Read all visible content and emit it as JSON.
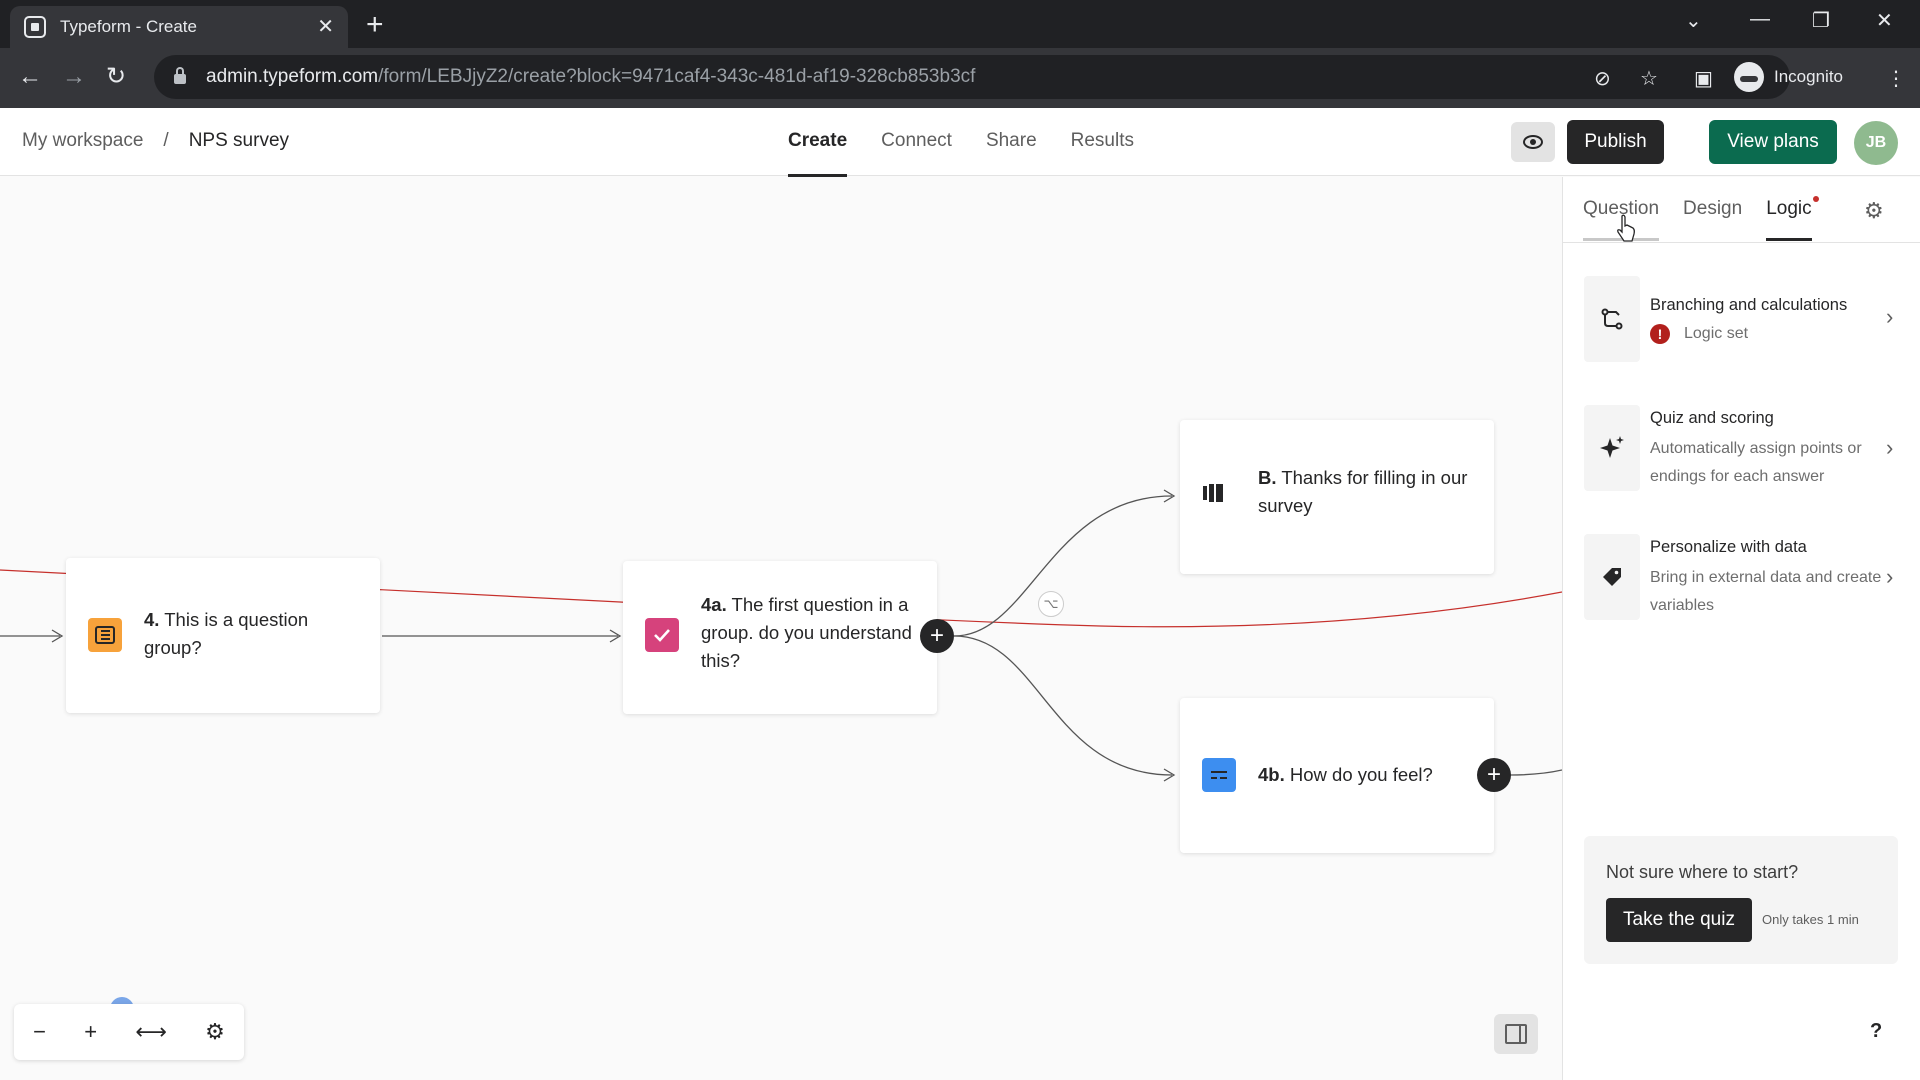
{
  "browser": {
    "tab_title": "Typeform - Create",
    "url_host": "admin.typeform.com",
    "url_path": "/form/LEBJjyZ2/create?block=9471caf4-343c-481d-af19-328cb853b3cf",
    "profile_label": "Incognito"
  },
  "header": {
    "breadcrumb": [
      "My workspace",
      "/",
      "NPS survey"
    ],
    "tabs": [
      "Create",
      "Connect",
      "Share",
      "Results"
    ],
    "active_tab": "Create",
    "publish_label": "Publish",
    "view_plans_label": "View plans",
    "avatar_initials": "JB"
  },
  "canvas": {
    "nodes": [
      {
        "id": "4",
        "number": "4.",
        "title": "This is a question group?",
        "icon": "question-group-icon",
        "color": "#f7a23b"
      },
      {
        "id": "4a",
        "number": "4a.",
        "title": "The first question in a group. do you understand this?",
        "icon": "checkbox-icon",
        "color": "#d6427c"
      },
      {
        "id": "B",
        "number": "B.",
        "title": "Thanks for filling in our survey",
        "icon": "ending-icon",
        "color": "#262627"
      },
      {
        "id": "4b",
        "number": "4b.",
        "title": "How do you feel?",
        "icon": "short-text-icon",
        "color": "#3d8ef0"
      }
    ]
  },
  "zoom_controls": [
    "−",
    "+",
    "⟷",
    "⚙"
  ],
  "panel": {
    "tabs": [
      "Question",
      "Design",
      "Logic"
    ],
    "active_tab": "Logic",
    "items": [
      {
        "title": "Branching and calculations",
        "subtitle": "Logic set",
        "icon": "branching-icon"
      },
      {
        "title": "Quiz and scoring",
        "subtitle": "Automatically assign points or endings for each answer",
        "icon": "sparkle-icon"
      },
      {
        "title": "Personalize with data",
        "subtitle": "Bring in external data and create variables",
        "icon": "tag-icon"
      }
    ],
    "quiz_prompt": "Not sure where to start?",
    "quiz_button": "Take the quiz",
    "quiz_note": "Only takes 1 min"
  },
  "help_label": "?",
  "colors": {
    "accent_green": "#0b6b4f",
    "logic_line": "#c6302c"
  }
}
